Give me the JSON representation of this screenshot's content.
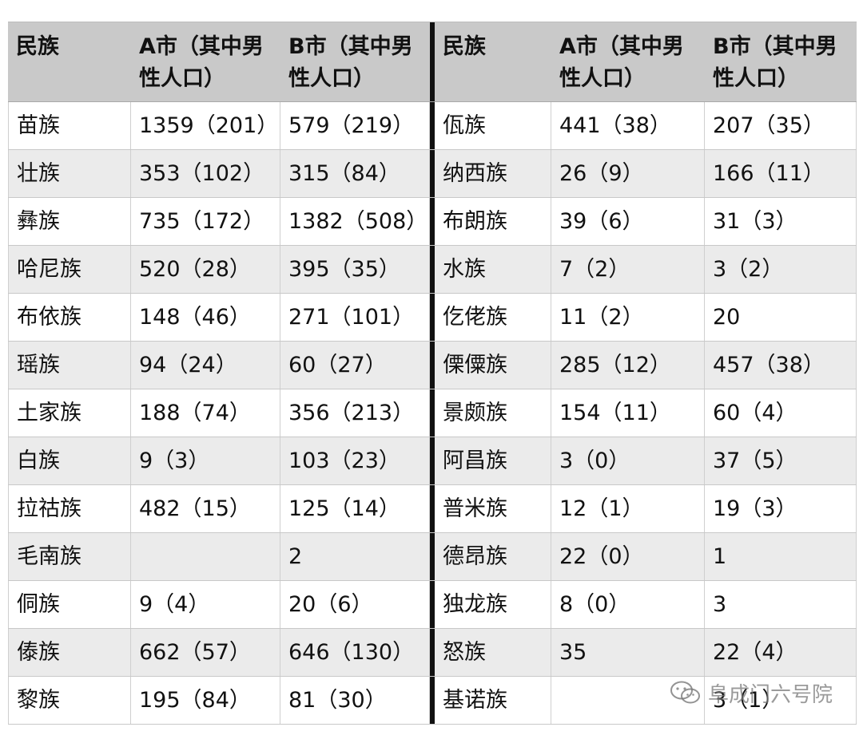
{
  "headers": [
    "民族",
    "A市（其中男性人口）",
    "B市（其中男性人口）",
    "民族",
    "A市（其中男性人口）",
    "B市（其中男性人口）"
  ],
  "rows": [
    [
      "苗族",
      "1359（201）",
      "579（219）",
      "佤族",
      "441（38）",
      "207（35）"
    ],
    [
      "壮族",
      "353（102）",
      "315（84）",
      "纳西族",
      "26（9）",
      "166（11）"
    ],
    [
      "彝族",
      "735（172）",
      "1382（508）",
      "布朗族",
      "39（6）",
      "31（3）"
    ],
    [
      "哈尼族",
      "520（28）",
      "395（35）",
      "水族",
      "7（2）",
      "3（2）"
    ],
    [
      "布依族",
      "148（46）",
      "271（101）",
      "仡佬族",
      "11（2）",
      "20"
    ],
    [
      "瑶族",
      "94（24）",
      "60（27）",
      "傈僳族",
      "285（12）",
      "457（38）"
    ],
    [
      "土家族",
      "188（74）",
      "356（213）",
      "景颇族",
      "154（11）",
      "60（4）"
    ],
    [
      "白族",
      "9（3）",
      "103（23）",
      "阿昌族",
      "3（0）",
      "37（5）"
    ],
    [
      "拉祜族",
      "482（15）",
      "125（14）",
      "普米族",
      "12（1）",
      "19（3）"
    ],
    [
      "毛南族",
      "",
      "2",
      "德昂族",
      "22（0）",
      "1"
    ],
    [
      "侗族",
      "9（4）",
      "20（6）",
      "独龙族",
      "8（0）",
      "3"
    ],
    [
      "傣族",
      "662（57）",
      "646（130）",
      "怒族",
      "35",
      "22（4）"
    ],
    [
      "黎族",
      "195（84）",
      "81（30）",
      "基诺族",
      "",
      "3（1）"
    ]
  ],
  "watermark": {
    "text": "阜成门六号院",
    "icon": "wechat-icon"
  }
}
